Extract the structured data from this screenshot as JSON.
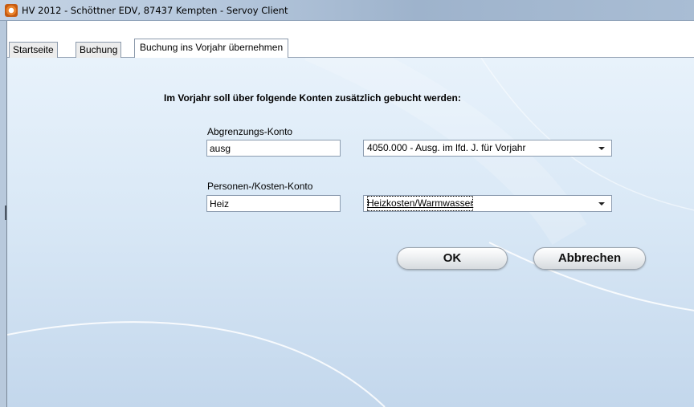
{
  "window": {
    "title": "HV 2012 - Schöttner EDV, 87437 Kempten  - Servoy Client"
  },
  "tabs": [
    {
      "label": "Startseite",
      "active": false
    },
    {
      "label": "Buchung",
      "active": false
    },
    {
      "label": "Buchung ins Vorjahr übernehmen",
      "active": true
    }
  ],
  "form": {
    "heading": "Im Vorjahr soll über folgende Konten zusätzlich gebucht werden:",
    "abgrenzung": {
      "label": "Abgrenzungs-Konto",
      "search_value": "ausg",
      "selected": "4050.000 - Ausg. im lfd. J. für Vorjahr"
    },
    "personen": {
      "label": "Personen-/Kosten-Konto",
      "search_value": "Heiz",
      "selected": "Heizkosten/Warmwasser"
    },
    "ok_label": "OK",
    "cancel_label": "Abbrechen"
  }
}
